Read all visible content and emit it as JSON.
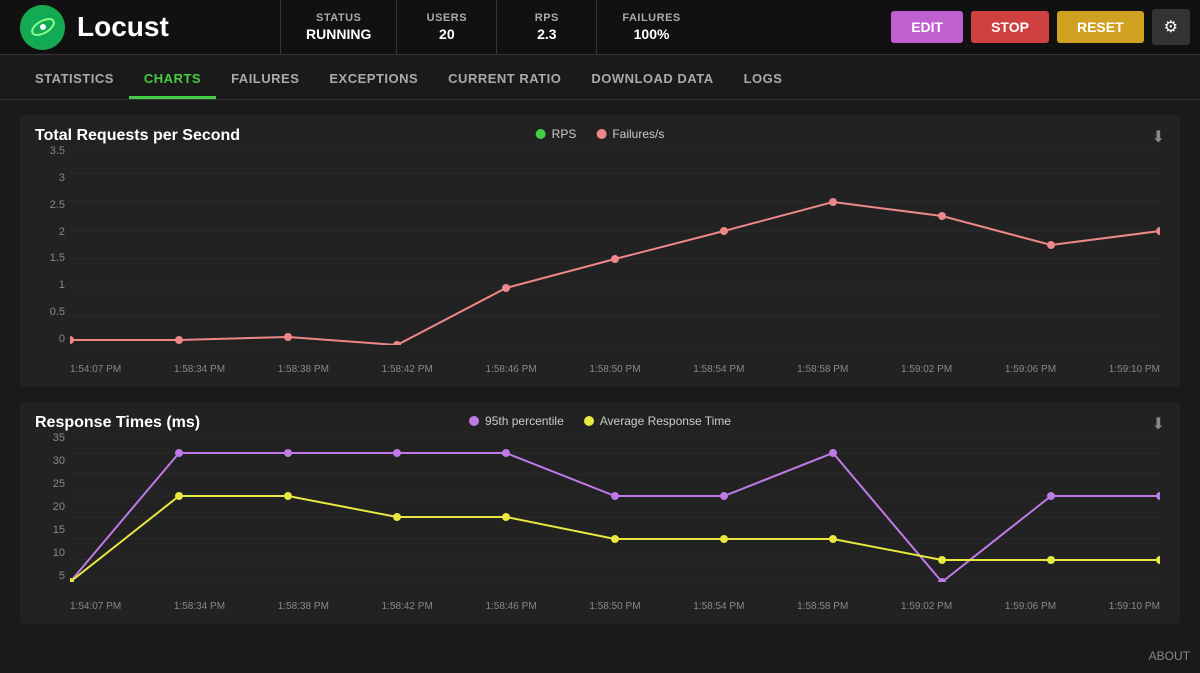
{
  "header": {
    "logo_text": "Locust",
    "status_label": "STATUS",
    "status_value": "RUNNING",
    "users_label": "USERS",
    "users_value": "20",
    "rps_label": "RPS",
    "rps_value": "2.3",
    "failures_label": "FAILURES",
    "failures_value": "100%",
    "btn_edit": "EDIT",
    "btn_stop": "STOP",
    "btn_reset": "RESET"
  },
  "nav": {
    "items": [
      {
        "label": "STATISTICS",
        "active": false
      },
      {
        "label": "CHARTS",
        "active": true
      },
      {
        "label": "FAILURES",
        "active": false
      },
      {
        "label": "EXCEPTIONS",
        "active": false
      },
      {
        "label": "CURRENT RATIO",
        "active": false
      },
      {
        "label": "DOWNLOAD DATA",
        "active": false
      },
      {
        "label": "LOGS",
        "active": false
      }
    ]
  },
  "chart1": {
    "title": "Total Requests per Second",
    "legend": [
      {
        "label": "RPS",
        "color": "#4c4"
      },
      {
        "label": "Failures/s",
        "color": "#e88"
      }
    ],
    "y_labels": [
      "3.5",
      "3",
      "2.5",
      "2",
      "1.5",
      "1",
      "0.5",
      "0"
    ],
    "x_labels": [
      "1:54:07 PM",
      "1:58:34 PM",
      "1:58:38 PM",
      "1:58:42 PM",
      "1:58:46 PM",
      "1:58:50 PM",
      "1:58:54 PM",
      "1:58:58 PM",
      "1:59:02 PM",
      "1:59:06 PM",
      "1:59:10 PM"
    ]
  },
  "chart2": {
    "title": "Response Times (ms)",
    "legend": [
      {
        "label": "95th percentile",
        "color": "#c07ae8"
      },
      {
        "label": "Average Response Time",
        "color": "#e8e840"
      }
    ],
    "y_labels": [
      "35",
      "30",
      "25",
      "20",
      "15",
      "10",
      "5"
    ],
    "x_labels": [
      "1:54:07 PM",
      "1:58:34 PM",
      "1:58:38 PM",
      "1:58:42 PM",
      "1:58:46 PM",
      "1:58:50 PM",
      "1:58:54 PM",
      "1:58:58 PM",
      "1:59:02 PM",
      "1:59:06 PM",
      "1:59:10 PM"
    ]
  },
  "about": "ABOUT"
}
